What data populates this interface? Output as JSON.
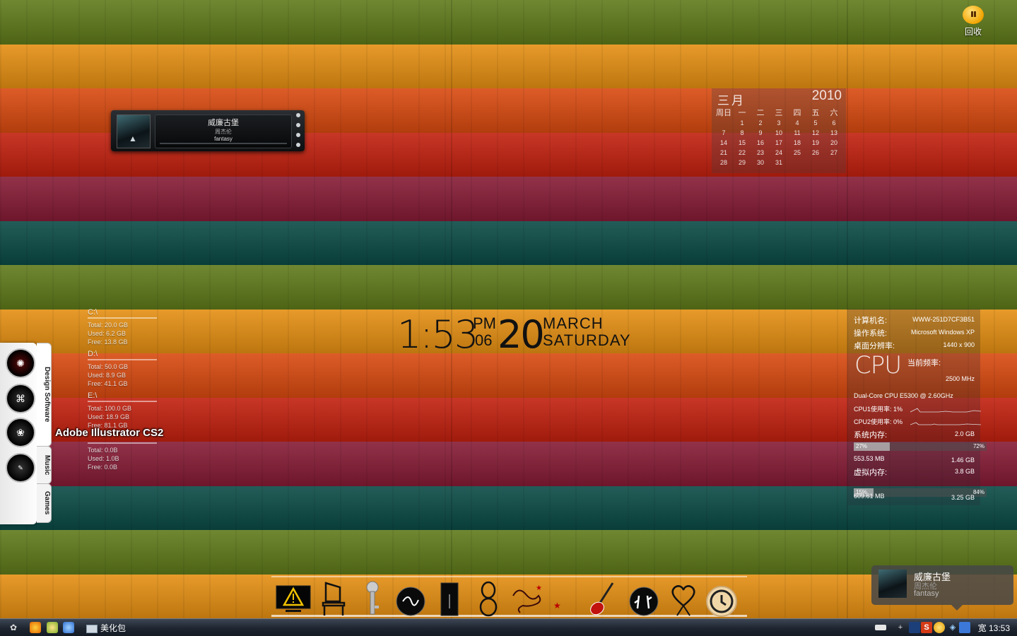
{
  "wallpaper": {
    "stripes": [
      "#5f7a1a",
      "#e58f12",
      "#d94a10",
      "#c2200e",
      "#861b35",
      "#0a4a45",
      "#5f7a1a",
      "#e58f12",
      "#d94a10",
      "#c2200e",
      "#861b35",
      "#0a4a45",
      "#5f7a1a",
      "#e58f12"
    ]
  },
  "recycle_bin": {
    "label": "回收",
    "icon": "recycle-bin-icon"
  },
  "music_player": {
    "title": "威廉古堡",
    "artist": "周杰伦",
    "album": "fantasy"
  },
  "calendar": {
    "month": "三月",
    "year": "2010",
    "weekdays": [
      "周日",
      "一",
      "二",
      "三",
      "四",
      "五",
      "六"
    ],
    "weeks": [
      [
        "",
        "1",
        "2",
        "3",
        "4",
        "5",
        "6"
      ],
      [
        "7",
        "8",
        "9",
        "10",
        "11",
        "12",
        "13"
      ],
      [
        "14",
        "15",
        "16",
        "17",
        "18",
        "19",
        "20"
      ],
      [
        "21",
        "22",
        "23",
        "24",
        "25",
        "26",
        "27"
      ],
      [
        "28",
        "29",
        "30",
        "31",
        "",
        "",
        ""
      ]
    ]
  },
  "drives": [
    {
      "name": "C:\\",
      "total": "Total: 20.0 GB",
      "used": "Used: 6.2 GB",
      "free": "Free: 13.8 GB"
    },
    {
      "name": "D:\\",
      "total": "Total: 50.0 GB",
      "used": "Used: 8.9 GB",
      "free": "Free: 41.1 GB"
    },
    {
      "name": "E:\\",
      "total": "Total: 100.0 GB",
      "used": "Used: 18.9 GB",
      "free": "Free: 81.1 GB"
    },
    {
      "name": "",
      "total": "Total: 0.0B",
      "used": "Used: 1.0B",
      "free": "Free: 0.0B"
    }
  ],
  "clock": {
    "time": "1:53",
    "ampm": "PM",
    "seconds": "06",
    "day": "20",
    "month": "MARCH",
    "weekday": "SATURDAY"
  },
  "sysmon": {
    "computer_name_label": "计算机名:",
    "computer_name": "WWW-251D7CF3B51",
    "os_label": "操作系统:",
    "os": "Microsoft Windows XP",
    "resolution_label": "桌面分辨率:",
    "resolution": "1440 x 900",
    "cpu_logo": "CPU",
    "freq_label": "当前频率:",
    "freq": "2500 MHz",
    "cpu_model": "Dual-Core CPU E5300 @ 2.60GHz",
    "cpu1_label": "CPU1使用率:",
    "cpu1": "1%",
    "cpu2_label": "CPU2使用率:",
    "cpu2": "0%",
    "mem_label": "系统内存:",
    "mem_total": "2.0 GB",
    "mem_used_pct": "27%",
    "mem_free_pct": "72%",
    "mem_fill": 27,
    "mem_used": "553.53 MB",
    "mem_free": "1.46 GB",
    "vmem_label": "虚拟内存:",
    "vmem_total": "3.8 GB",
    "vmem_used_pct": "15%",
    "vmem_free_pct": "84%",
    "vmem_fill": 15,
    "vmem_used": "609.61 MB",
    "vmem_free": "3.25 GB"
  },
  "side_dock": {
    "tabs": [
      "Design Software",
      "Music",
      "Games"
    ],
    "hover_label": "Adobe Illustrator CS2",
    "icons": [
      "photoshop-icon",
      "illustrator-icon",
      "app-icon",
      "app-icon-4"
    ]
  },
  "bottom_dock": {
    "icons": [
      "warning-monitor-icon",
      "chair-icon",
      "key-icon",
      "signature-icon",
      "phone-icon",
      "figure-icon",
      "ornament-icon",
      "stars-icon",
      "guitar-icon",
      "dancers-icon",
      "heart-icon",
      "clock-restore-icon"
    ]
  },
  "notification": {
    "title": "威廉古堡",
    "artist": "周杰伦",
    "album": "fantasy"
  },
  "taskbar": {
    "task_label": "美化包",
    "clock": "13:53",
    "tray_ime": "宽"
  }
}
